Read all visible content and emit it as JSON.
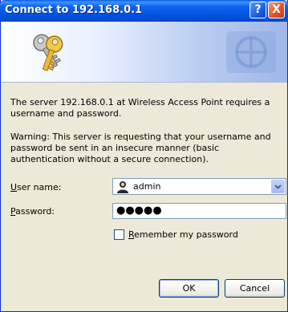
{
  "window": {
    "title": "Connect to 192.168.0.1",
    "help_glyph": "?",
    "close_glyph": "X"
  },
  "banner": {
    "icon": "keys-icon"
  },
  "message": {
    "line1": "The server 192.168.0.1 at Wireless Access Point requires a username and password.",
    "line2": "Warning: This server is requesting that your username and password be sent in an insecure manner (basic authentication without a secure connection)."
  },
  "form": {
    "username_label_key": "U",
    "username_label_rest": "ser name:",
    "username_value": "admin",
    "username_icon": "user-icon",
    "password_label_key": "P",
    "password_label_rest": "assword:",
    "password_mask": "●●●●●",
    "remember_key": "R",
    "remember_rest": "emember my password",
    "remember_checked": false
  },
  "buttons": {
    "ok": "OK",
    "cancel": "Cancel"
  },
  "colors": {
    "titlebar": "#0052df",
    "dialog_bg": "#ece9d8",
    "close": "#e2562b"
  }
}
